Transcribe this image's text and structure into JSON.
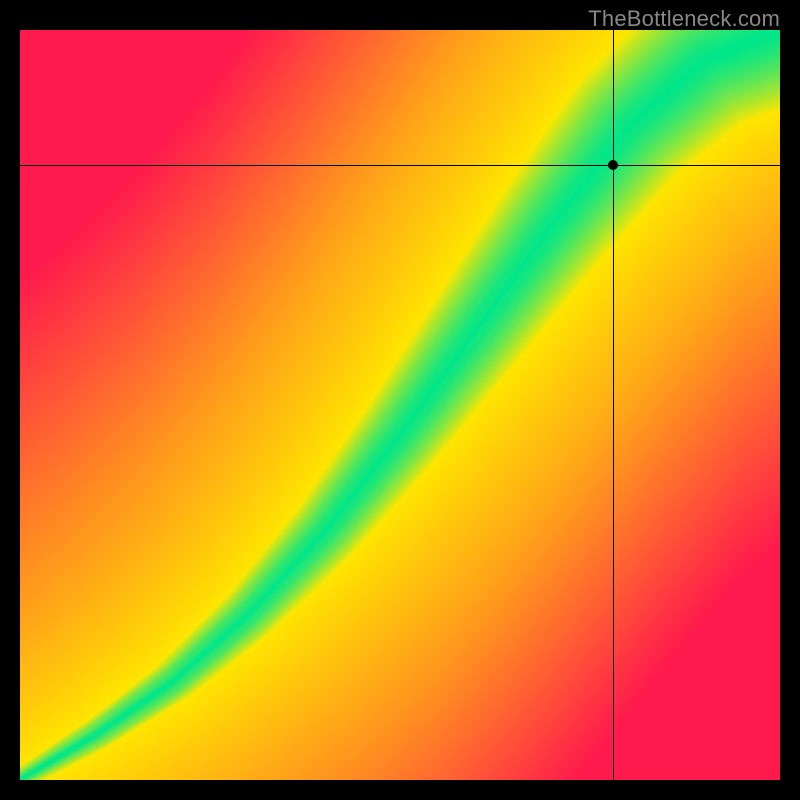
{
  "watermark": "TheBottleneck.com",
  "chart_data": {
    "type": "heatmap",
    "title": "",
    "xlabel": "",
    "ylabel": "",
    "xlim": [
      0,
      1
    ],
    "ylim": [
      0,
      1
    ],
    "colorscale": {
      "min_color": "#ff1a4d",
      "mid_color": "#ffe600",
      "ridge_color": "#00e68a",
      "description": "red-yellow-green gradient; green along diagonal optimum ridge, fading through yellow to red away from it"
    },
    "ridge_curve": {
      "description": "optimum (green) ridge path in normalized x,y coords, bottom-left origin",
      "points": [
        [
          0.0,
          0.0
        ],
        [
          0.1,
          0.06
        ],
        [
          0.2,
          0.13
        ],
        [
          0.3,
          0.22
        ],
        [
          0.4,
          0.33
        ],
        [
          0.5,
          0.46
        ],
        [
          0.6,
          0.6
        ],
        [
          0.7,
          0.74
        ],
        [
          0.8,
          0.87
        ],
        [
          0.9,
          0.96
        ],
        [
          1.0,
          1.0
        ]
      ]
    },
    "crosshair": {
      "x": 0.78,
      "y": 0.82
    }
  }
}
